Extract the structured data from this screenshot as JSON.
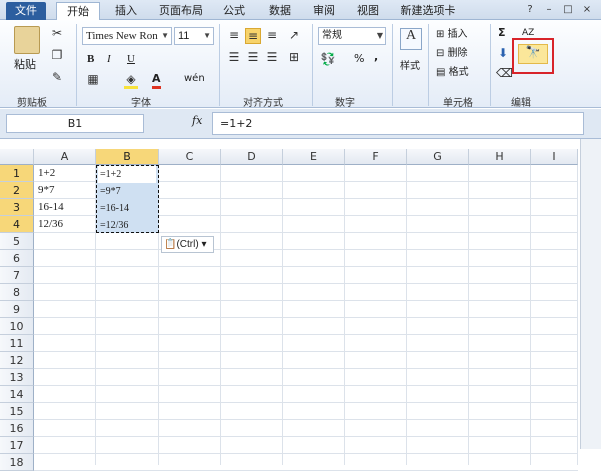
{
  "tabs": [
    "文件",
    "开始",
    "插入",
    "页面布局",
    "公式",
    "数据",
    "审阅",
    "视图",
    "新建选项卡"
  ],
  "window_controls": [
    "?",
    "–",
    "□",
    "×"
  ],
  "groups": {
    "clipboard": "剪贴板",
    "font": "字体",
    "alignment": "对齐方式",
    "number": "数字",
    "cells": "单元格",
    "editing": "编辑"
  },
  "clipboard": {
    "paste": "粘贴"
  },
  "font": {
    "name": "Times New Ron",
    "size": "11",
    "bold": "B",
    "italic": "I",
    "underline": "U",
    "color_a": "A",
    "wen": "wén"
  },
  "number": {
    "format": "常规",
    "percent": "%",
    "comma": ","
  },
  "styles": {
    "label": "样式"
  },
  "cells": {
    "insert": "插入",
    "delete": "删除",
    "format": "格式"
  },
  "editing": {
    "sum": "Σ",
    "sort": "AZ"
  },
  "formula_bar": {
    "name_box": "B1",
    "fx": "fx",
    "formula": "=1+2"
  },
  "columns": [
    "A",
    "B",
    "C",
    "D",
    "E",
    "F",
    "G",
    "H",
    "I"
  ],
  "rows": [
    "1",
    "2",
    "3",
    "4",
    "5",
    "6",
    "7",
    "8",
    "9",
    "10",
    "11",
    "12",
    "13",
    "14",
    "15",
    "16",
    "17",
    "18"
  ],
  "cells_a": [
    "1+2",
    "9*7",
    "16-14",
    "12/36"
  ],
  "cells_b": [
    "=1+2",
    "=9*7",
    "=16-14",
    "=12/36"
  ],
  "paste_tip": "(Ctrl)",
  "accent": "#2c5e9f",
  "highlight_box": "#d8242a"
}
